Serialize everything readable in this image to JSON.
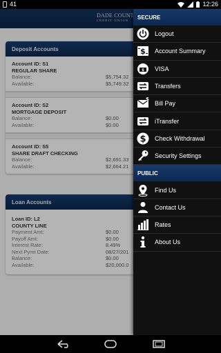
{
  "status_bar": {
    "notification_count": "41",
    "time": "12:26"
  },
  "app_bar": {
    "logo_line1": "DADE COUNTY FEDERAL",
    "logo_line2": "CREDIT UNION"
  },
  "deposit_card": {
    "title": "Deposit Accounts",
    "accounts": [
      {
        "id": "Account ID: S1",
        "name": "REGULAR SHARE",
        "balance_label": "Balance:",
        "balance": "$5,754.32",
        "available_label": "Available:",
        "available": "$5,749.32"
      },
      {
        "id": "Account ID: S2",
        "name": "MORTGAGE DEPOSIT",
        "balance_label": "Balance:",
        "balance": "$0.00",
        "available_label": "Available:",
        "available": "$0.00"
      },
      {
        "id": "Account ID: S5",
        "name": "SHARE DRAFT CHECKING",
        "balance_label": "Balance:",
        "balance": "$2,691.33",
        "available_label": "Available:",
        "available": "$2,664.21"
      }
    ]
  },
  "loan_card": {
    "title": "Loan Accounts",
    "loan": {
      "id": "Loan ID: L2",
      "name": "COUNTY LINE",
      "rows": [
        {
          "label": "Payment Amt:",
          "value": "$0.00"
        },
        {
          "label": "Payoff Amt:",
          "value": "$0.00"
        },
        {
          "label": "Interest Rate:",
          "value": "8.49%"
        },
        {
          "label": "Next Pymt Date:",
          "value": "08/27/201"
        },
        {
          "label": "Balance:",
          "value": "$0.00"
        },
        {
          "label": "Available:",
          "value": "$20,000.0"
        }
      ]
    }
  },
  "drawer": {
    "secure_header": "SECURE",
    "secure_items": [
      {
        "label": "Logout",
        "icon": "power-icon"
      },
      {
        "label": "Account Summary",
        "icon": "money-icon"
      },
      {
        "label": "VISA",
        "icon": "visa-card-icon"
      },
      {
        "label": "Transfers",
        "icon": "transfer-arrows-icon"
      },
      {
        "label": "Bill Pay",
        "icon": "bill-envelope-icon"
      },
      {
        "label": "iTransfer",
        "icon": "itransfer-icon"
      },
      {
        "label": "Check Withdrawal",
        "icon": "dollar-coin-icon"
      },
      {
        "label": "Security Settings",
        "icon": "key-icon"
      }
    ],
    "public_header": "PUBLIC",
    "public_items": [
      {
        "label": "Find Us",
        "icon": "map-pin-icon"
      },
      {
        "label": "Contact Us",
        "icon": "contact-icon"
      },
      {
        "label": "Rates",
        "icon": "bar-chart-icon"
      },
      {
        "label": "About Us",
        "icon": "info-icon"
      }
    ]
  },
  "colors": {
    "header_navy": "#0d2850",
    "drawer_bg": "#111111",
    "content_bg": "#f1f1f1"
  }
}
